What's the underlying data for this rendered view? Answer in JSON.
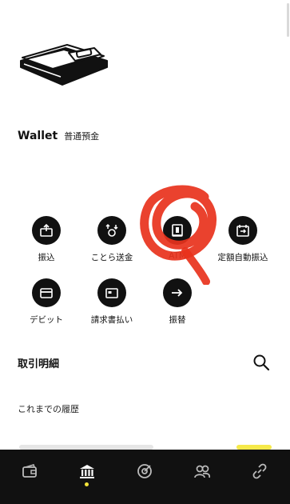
{
  "account": {
    "title": "Wallet",
    "type": "普通預金"
  },
  "actions": [
    {
      "label": "振込",
      "icon": "transfer-in-icon"
    },
    {
      "label": "ことら送金",
      "icon": "cotra-send-icon"
    },
    {
      "label": "ATM",
      "icon": "atm-icon"
    },
    {
      "label": "定額自動振込",
      "icon": "scheduled-transfer-icon"
    },
    {
      "label": "デビット",
      "icon": "debit-card-icon"
    },
    {
      "label": "請求書払い",
      "icon": "bill-pay-icon"
    },
    {
      "label": "振替",
      "icon": "arrow-right-icon"
    }
  ],
  "transactions": {
    "title": "取引明細",
    "history_label": "これまでの履歴"
  },
  "tabbar": {
    "items": [
      "wallet-icon",
      "bank-icon",
      "target-icon",
      "people-icon",
      "link-icon"
    ],
    "active_index": 1
  },
  "colors": {
    "background": "#ffffff",
    "icon_circle": "#111111",
    "tabbar": "#111111",
    "active_dot": "#f3e33a",
    "scribble": "#e8321c"
  }
}
